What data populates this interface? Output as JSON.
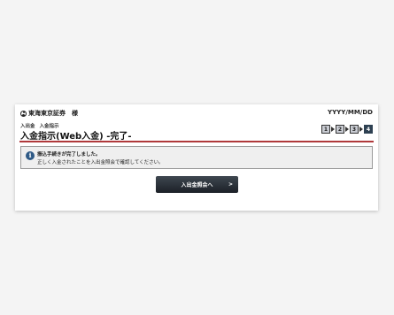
{
  "header": {
    "user_name": "東海東京証券",
    "user_suffix": "様",
    "date": "YYYY/MM/DD"
  },
  "breadcrumb": [
    "入出金",
    "入金指示"
  ],
  "page_title": "入金指示(Web入金) -完了-",
  "steps": {
    "items": [
      "1",
      "2",
      "3",
      "4"
    ],
    "current": 4
  },
  "message": {
    "icon": "info-icon",
    "line1": "振込手続きが完了しました。",
    "line2": "正しく入金されたことを入出金照会で確認してください。"
  },
  "action_button": {
    "label": "入出金照会へ",
    "arrow": ">"
  },
  "colors": {
    "accent_red": "#b0393b",
    "info_blue": "#2f5a86",
    "step_active": "#2e4152",
    "button_dark": "#1b2027"
  }
}
